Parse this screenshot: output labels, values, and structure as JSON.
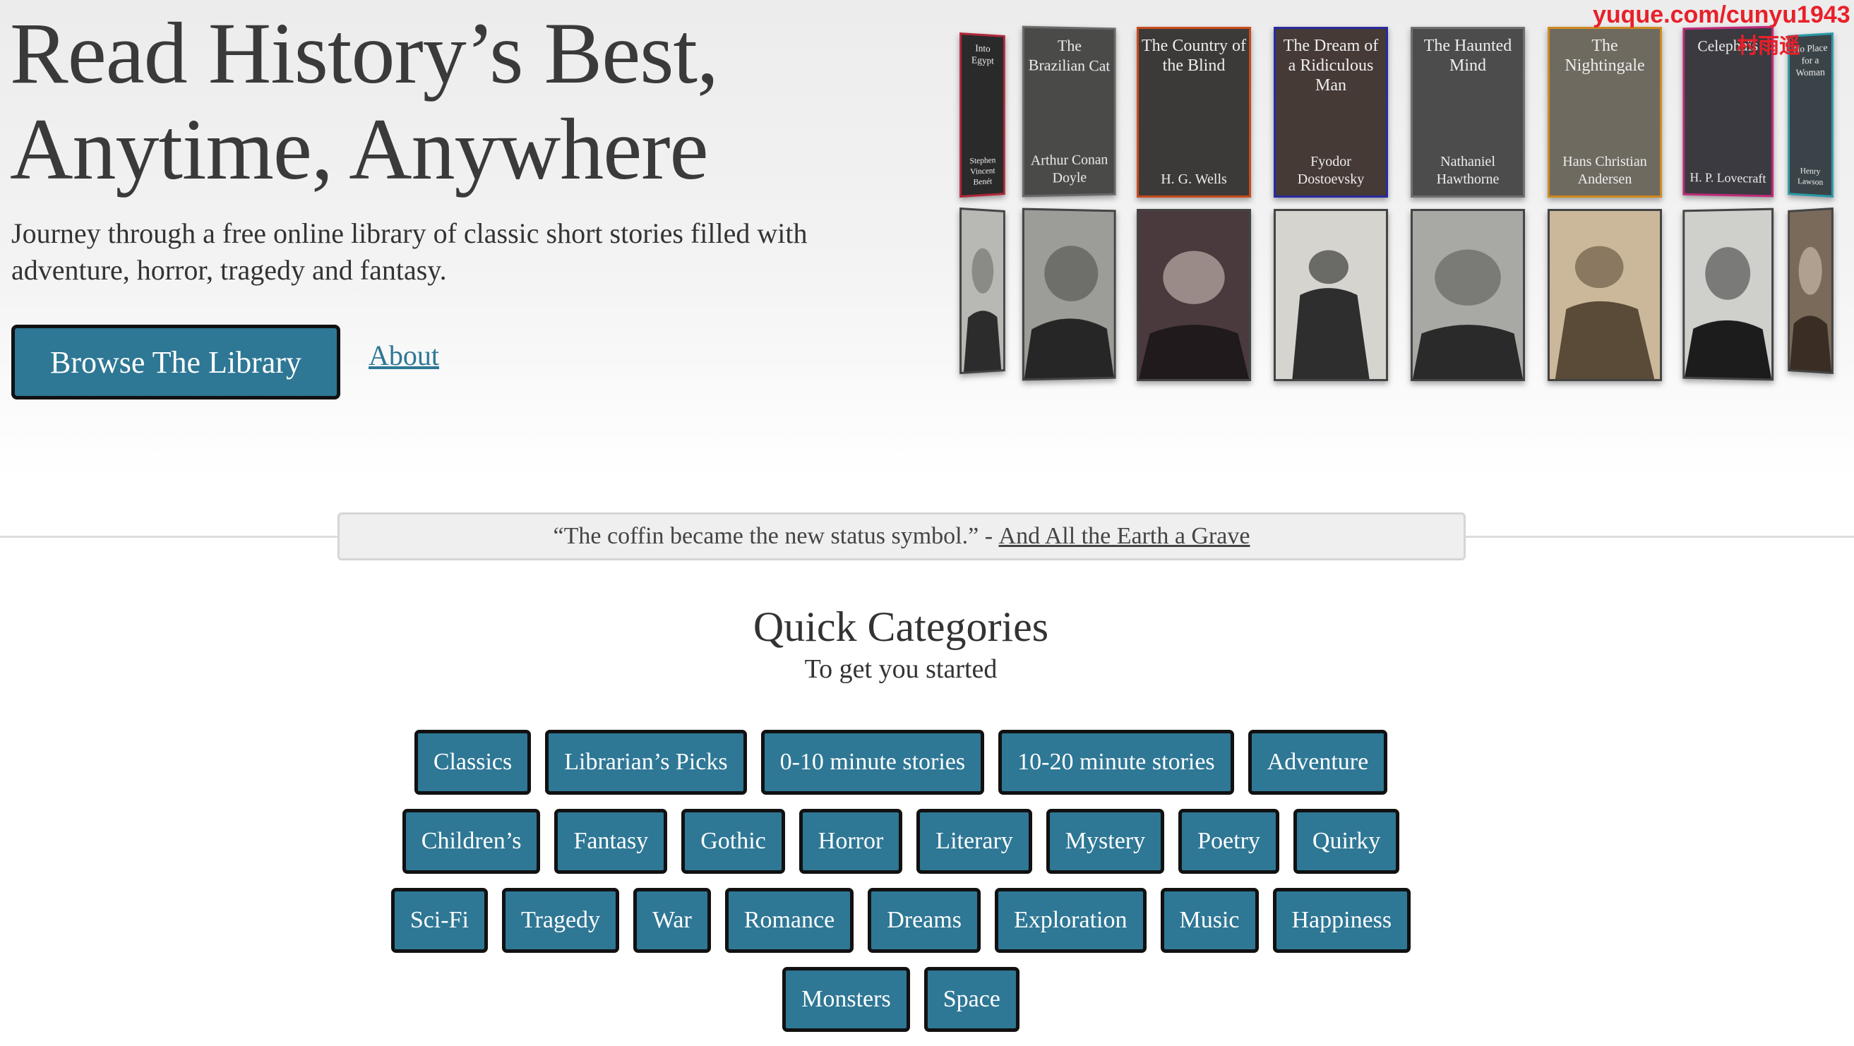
{
  "hero": {
    "headline_line1": "Read History’s Best,",
    "headline_line2": "Anytime, Anywhere",
    "subheading": "Journey through a free online library of classic short stories filled with adventure, horror, tragedy and fantasy.",
    "browse_button": "Browse The Library",
    "about_link": "About"
  },
  "books": [
    {
      "title": "Into Egypt",
      "author": "Stephen Vincent Benét",
      "color": "#2a2a2a",
      "border": "#b0283a"
    },
    {
      "title": "The Brazilian Cat",
      "author": "Arthur Conan Doyle",
      "color": "#4a4a48",
      "border": "#6a6a6a"
    },
    {
      "title": "The Country of the Blind",
      "author": "H. G. Wells",
      "color": "#3c3a38",
      "border": "#c84a1e"
    },
    {
      "title": "The Dream of a Ridiculous Man",
      "author": "Fyodor Dostoevsky",
      "color": "#463a36",
      "border": "#2a2aa0"
    },
    {
      "title": "The Haunted Mind",
      "author": "Nathaniel Hawthorne",
      "color": "#4c4c4c",
      "border": "#707070"
    },
    {
      "title": "The Nightingale",
      "author": "Hans Christian Andersen",
      "color": "#6e6a60",
      "border": "#d08a20"
    },
    {
      "title": "Celephaïs",
      "author": "H. P. Lovecraft",
      "color": "#3a3a40",
      "border": "#c02a7a"
    },
    {
      "title": "No Place for a Woman",
      "author": "Henry Lawson",
      "color": "#3a4448",
      "border": "#2a9aa8"
    }
  ],
  "quote": {
    "text": "“The coffin became the new status symbol.” - ",
    "source": "And All the Earth a Grave"
  },
  "categories": {
    "title": "Quick Categories",
    "subtitle": "To get you started",
    "row1": [
      "Classics",
      "Librarian’s Picks",
      "0-10 minute stories",
      "10-20 minute stories",
      "Adventure"
    ],
    "row2": [
      "Children’s",
      "Fantasy",
      "Gothic",
      "Horror",
      "Literary",
      "Mystery",
      "Poetry",
      "Quirky"
    ],
    "row3": [
      "Sci-Fi",
      "Tragedy",
      "War",
      "Romance",
      "Dreams",
      "Exploration",
      "Music",
      "Happiness"
    ],
    "row4": [
      "Monsters",
      "Space"
    ]
  },
  "watermark": {
    "url": "yuque.com/cunyu1943",
    "handle": "村雨遥"
  },
  "colors": {
    "accent": "#2e7795",
    "watermark": "#e8202a"
  }
}
